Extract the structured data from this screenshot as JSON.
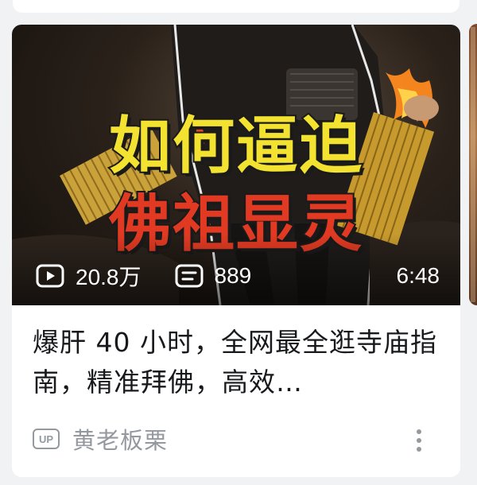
{
  "card": {
    "cover": {
      "title_line1": "如何逼迫",
      "title_line2": "佛祖显灵",
      "colors": {
        "line1": "#f4e231",
        "line2": "#e23a22"
      }
    },
    "stats": {
      "views": "20.8万",
      "comments": "889",
      "duration": "6:48",
      "views_icon": "play-icon",
      "comments_icon": "danmaku-icon"
    },
    "title": "爆肝 40 小时，全网最全逛寺庙指南，精准拜佛，高效…",
    "uploader": {
      "badge": "UP",
      "name": "黄老板栗"
    },
    "more_icon": "more-vertical-icon"
  }
}
